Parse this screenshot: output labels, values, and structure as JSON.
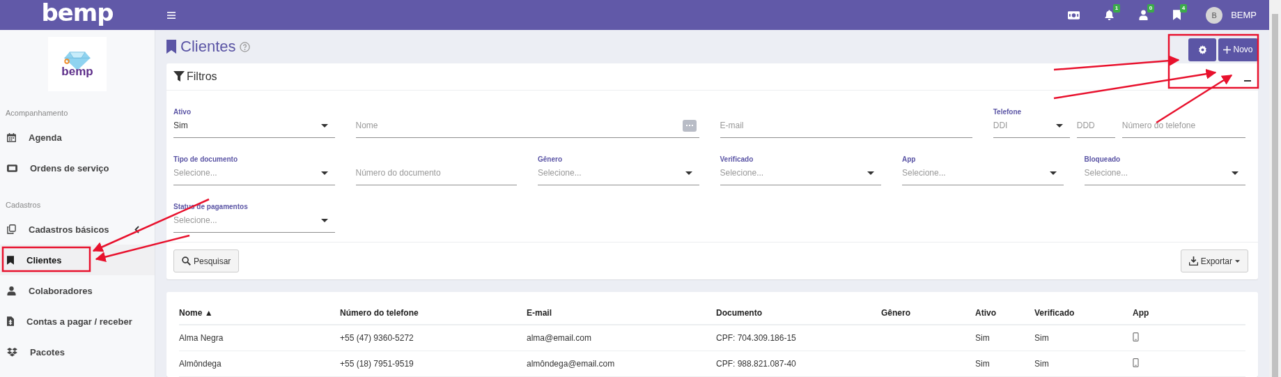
{
  "topbar": {
    "logo": "bemp",
    "badges": [
      {
        "count": "1"
      },
      {
        "count": "0"
      },
      {
        "count": "4"
      }
    ],
    "user": {
      "initial": "B",
      "name": "BEMP"
    }
  },
  "sidebar": {
    "logo": "bemp",
    "sections": [
      {
        "title": "Acompanhamento",
        "items": [
          {
            "label": "Agenda",
            "kind": "link",
            "selected": false
          },
          {
            "label": "Ordens de serviço",
            "kind": "link",
            "selected": false
          }
        ]
      },
      {
        "title": "Cadastros",
        "items": [
          {
            "label": "Cadastros básicos",
            "kind": "group",
            "selected": false
          },
          {
            "label": "Clientes",
            "kind": "link",
            "selected": true
          },
          {
            "label": "Colaboradores",
            "kind": "link",
            "selected": false
          },
          {
            "label": "Contas a pagar / receber",
            "kind": "link",
            "selected": false
          },
          {
            "label": "Pacotes",
            "kind": "link",
            "selected": false
          }
        ]
      }
    ]
  },
  "page": {
    "title": "Clientes",
    "new_button": "Novo"
  },
  "filters": {
    "title": "Filtros",
    "fields": [
      {
        "kind": "select",
        "label": "Ativo",
        "value": "Sim"
      },
      {
        "kind": "text",
        "placeholder": "Nome",
        "more": true
      },
      {
        "kind": "text",
        "placeholder": "E-mail",
        "more": false
      },
      {
        "kind": "phone",
        "label": "Telefone",
        "ddi": "DDI",
        "ddd": "DDD",
        "placeholder": "Número do telefone"
      },
      {
        "kind": "select",
        "label": "Tipo de documento",
        "placeholder": "Selecione..."
      },
      {
        "kind": "text",
        "placeholder": "Número do documento",
        "more": false
      },
      {
        "kind": "select",
        "label": "Gênero",
        "placeholder": "Selecione..."
      },
      {
        "kind": "select",
        "label": "Verificado",
        "placeholder": "Selecione..."
      },
      {
        "kind": "select",
        "label": "App",
        "placeholder": "Selecione..."
      },
      {
        "kind": "select",
        "label": "Bloqueado",
        "placeholder": "Selecione..."
      },
      {
        "kind": "select",
        "label": "Status de pagamentos",
        "placeholder": "Selecione..."
      }
    ],
    "search_button": "Pesquisar",
    "export_button": "Exportar"
  },
  "table": {
    "columns": [
      "Nome ▲",
      "Número do telefone",
      "E-mail",
      "Documento",
      "Gênero",
      "Ativo",
      "Verificado",
      "App"
    ],
    "rows": [
      {
        "cells": [
          "Alma Negra",
          "+55 (47) 9360-5272",
          "alma@email.com",
          "CPF: 704.309.186-15",
          "",
          "Sim",
          "Sim"
        ],
        "app": true
      },
      {
        "cells": [
          "Almôndega",
          "+55 (18) 7951-9519",
          "almôndega@email.com",
          "CPF: 988.821.087-40",
          "",
          "Sim",
          "Sim"
        ],
        "app": true
      }
    ]
  }
}
